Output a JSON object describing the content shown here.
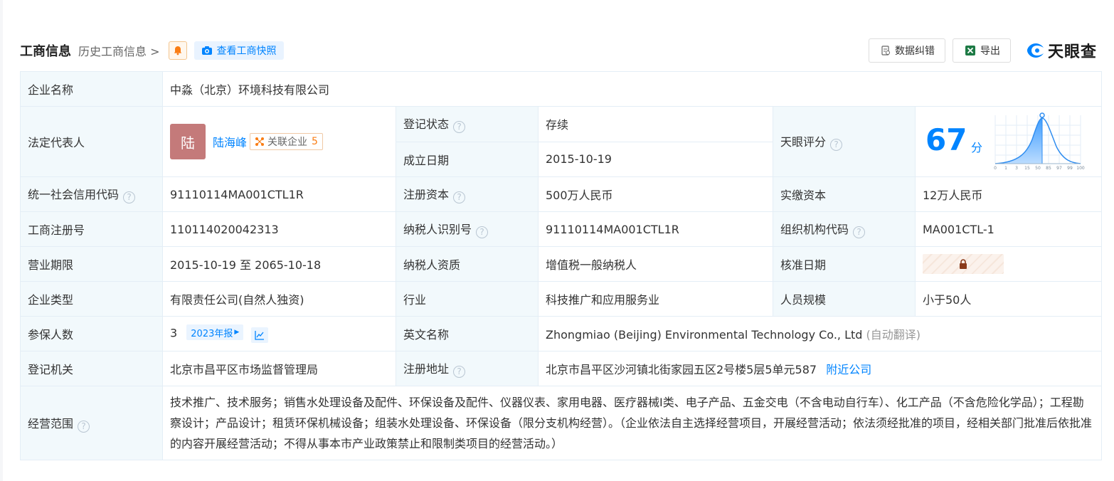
{
  "header": {
    "title": "工商信息",
    "history_link": "历史工商信息",
    "snapshot_button": "查看工商快照",
    "correction_button": "数据纠错",
    "export_button": "导出",
    "logo_text": "天眼查"
  },
  "colors": {
    "brand_blue": "#0084ff",
    "label_bg": "#f2f9fc",
    "status_green": "#1aad19",
    "accent_orange": "#fa7d14",
    "avatar_bg": "#c47a7a"
  },
  "company": {
    "name_label": "企业名称",
    "name_value": "中淼（北京）环境科技有限公司",
    "rep_label": "法定代表人",
    "rep_avatar_char": "陆",
    "rep_name": "陆海峰",
    "related_label": "关联企业",
    "related_count": "5",
    "status_label": "登记状态",
    "status_value": "存续",
    "founded_label": "成立日期",
    "founded_value": "2015-10-19",
    "score_label": "天眼评分",
    "score_value": "67",
    "score_unit": "分",
    "score_axis": [
      "0",
      "1",
      "3",
      "15",
      "50",
      "85",
      "97",
      "99",
      "100"
    ],
    "credit_label": "统一社会信用代码",
    "credit_value": "91110114MA001CTL1R",
    "capital_label": "注册资本",
    "capital_value": "500万人民币",
    "paid_label": "实缴资本",
    "paid_value": "12万人民币",
    "regno_label": "工商注册号",
    "regno_value": "110114020042313",
    "taxid_label": "纳税人识别号",
    "taxid_value": "91110114MA001CTL1R",
    "orgcode_label": "组织机构代码",
    "orgcode_value": "MA001CTL-1",
    "term_label": "营业期限",
    "term_value": "2015-10-19 至 2065-10-18",
    "taxq_label": "纳税人资质",
    "taxq_value": "增值税一般纳税人",
    "approve_label": "核准日期",
    "type_label": "企业类型",
    "type_value": "有限责任公司(自然人独资)",
    "industry_label": "行业",
    "industry_value": "科技推广和应用服务业",
    "staff_label": "人员规模",
    "staff_value": "小于50人",
    "insured_label": "参保人数",
    "insured_value": "3",
    "insured_year": "2023年报",
    "en_label": "英文名称",
    "en_value": "Zhongmiao (Beijing) Environmental Technology Co., Ltd",
    "en_note": "(自动翻译)",
    "authority_label": "登记机关",
    "authority_value": "北京市昌平区市场监督管理局",
    "address_label": "注册地址",
    "address_value": "北京市昌平区沙河镇北街家园五区2号楼5层5单元587",
    "nearby_link": "附近公司",
    "scope_label": "经营范围",
    "scope_value": "技术推广、技术服务；销售水处理设备及配件、环保设备及配件、仪器仪表、家用电器、医疗器械Ⅰ类、电子产品、五金交电（不含电动自行车）、化工产品（不含危险化学品）；工程勘察设计；产品设计；租赁环保机械设备；组装水处理设备、环保设备（限分支机构经营）。（企业依法自主选择经营项目，开展经营活动；依法须经批准的项目，经相关部门批准后依批准的内容开展经营活动；不得从事本市产业政策禁止和限制类项目的经营活动。）"
  }
}
